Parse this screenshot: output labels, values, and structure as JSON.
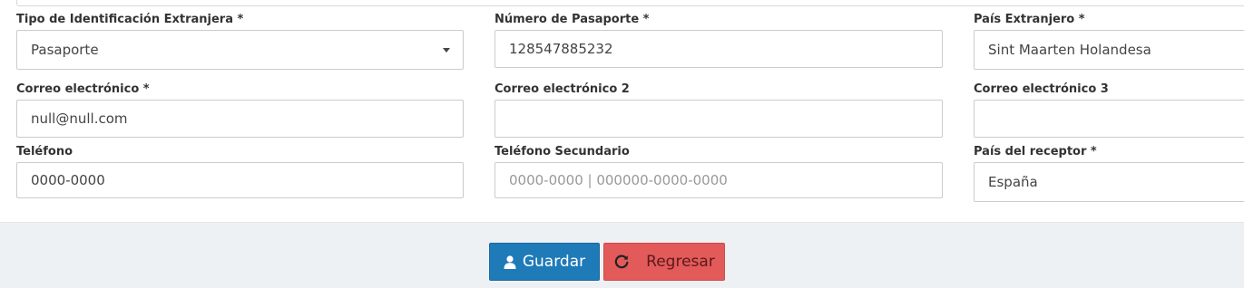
{
  "form": {
    "row1": {
      "id_type": {
        "label": "Tipo de Identificación Extranjera *",
        "value": "Pasaporte"
      },
      "passport": {
        "label": "Número de Pasaporte *",
        "value": "128547885232"
      },
      "country": {
        "label": "País Extranjero *",
        "value": "Sint Maarten Holandesa"
      }
    },
    "row2": {
      "email1": {
        "label": "Correo electrónico *",
        "value": "null@null.com"
      },
      "email2": {
        "label": "Correo electrónico 2",
        "value": ""
      },
      "email3": {
        "label": "Correo electrónico 3",
        "value": ""
      }
    },
    "row3": {
      "phone": {
        "label": "Teléfono",
        "value": "0000-0000"
      },
      "phone2": {
        "label": "Teléfono Secundario",
        "placeholder": "0000-0000 | 000000-0000-0000"
      },
      "receiver_country": {
        "label": "País del receptor *",
        "value": "España"
      }
    }
  },
  "actions": {
    "save_label": "Guardar",
    "back_label": "Regresar"
  },
  "icons": {
    "save": "user-icon",
    "back": "refresh-icon"
  },
  "colors": {
    "save_button": "#1f7ab8",
    "back_button": "#e35a5a",
    "footer_bg": "#eef1f3"
  }
}
